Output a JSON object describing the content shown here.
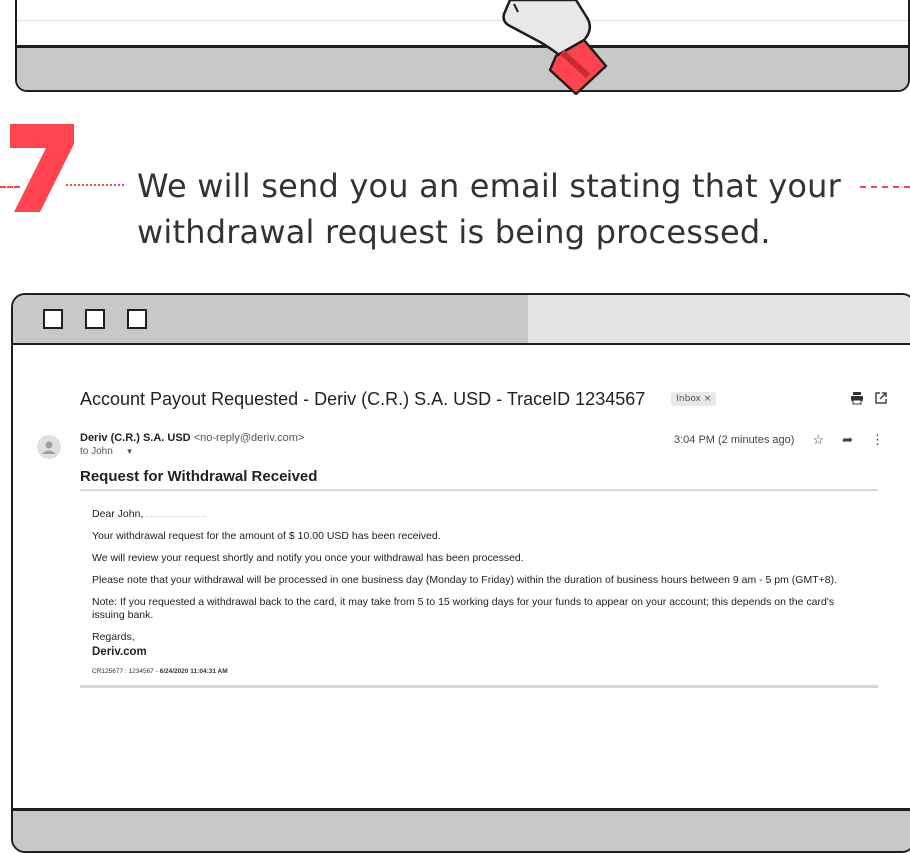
{
  "step": {
    "number": "7",
    "text": "We will send you an email stating that your withdrawal request is being processed."
  },
  "colors": {
    "accent": "#ff444f",
    "window_chrome": "#c8c8c8",
    "border": "#1e1e1e"
  },
  "email": {
    "subject": "Account Payout Requested - Deriv (C.R.) S.A. USD - TraceID 1234567",
    "label_badge": "Inbox ×",
    "sender_name": "Deriv (C.R.) S.A. USD",
    "sender_email": "<no-reply@deriv.com>",
    "to_line": "to John",
    "timestamp": "3:04 PM (2 minutes ago)",
    "icons": [
      "print-icon",
      "popout-icon",
      "star-icon",
      "reply-icon",
      "more-icon",
      "avatar-icon",
      "chevron-down-icon"
    ],
    "heading": "Request for Withdrawal Received",
    "greeting": "Dear John,",
    "paragraphs": [
      "Your withdrawal request for the amount of $ 10.00 USD has been received.",
      "We will review your request shortly and notify you once your withdrawal has been processed.",
      "Please note that your withdrawal will be processed in one business day (Monday to Friday) within the duration of business hours between 9 am - 5 pm (GMT+8).",
      "Note: If you requested a withdrawal back to the card, it may take from 5 to 15 working days for your funds to appear on your account; this depends on the card's issuing bank."
    ],
    "closing": "Regards,",
    "signature": "Deriv.com",
    "reference_prefix": "CR125677 : 1234567 - ",
    "reference_date": "6/24/2020 11:04:31 AM"
  }
}
